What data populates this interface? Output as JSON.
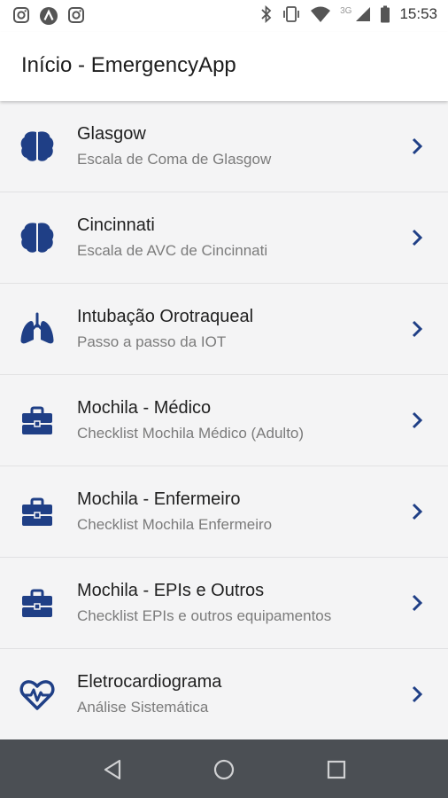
{
  "status_bar": {
    "time": "15:53",
    "network": "3G",
    "left_icons": [
      "instagram-icon",
      "app-a-icon",
      "instagram-icon"
    ],
    "right_icons": [
      "bluetooth-icon",
      "vibrate-icon",
      "wifi-icon",
      "signal-icon",
      "battery-icon"
    ]
  },
  "app_bar": {
    "title": "Início - EmergencyApp"
  },
  "colors": {
    "accent": "#1f3f86",
    "background": "#f4f4f5",
    "nav_bar": "#4b4f54"
  },
  "menu": {
    "items": [
      {
        "title": "Glasgow",
        "subtitle": "Escala de Coma de Glasgow",
        "icon": "brain-icon"
      },
      {
        "title": "Cincinnati",
        "subtitle": "Escala de AVC de Cincinnati",
        "icon": "brain-icon"
      },
      {
        "title": "Intubação Orotraqueal",
        "subtitle": "Passo a passo da IOT",
        "icon": "lungs-icon"
      },
      {
        "title": "Mochila - Médico",
        "subtitle": "Checklist Mochila Médico (Adulto)",
        "icon": "toolbox-icon"
      },
      {
        "title": "Mochila - Enfermeiro",
        "subtitle": "Checklist Mochila Enfermeiro",
        "icon": "toolbox-icon"
      },
      {
        "title": "Mochila - EPIs e Outros",
        "subtitle": "Checklist EPIs e outros equipamentos",
        "icon": "toolbox-icon"
      },
      {
        "title": "Eletrocardiograma",
        "subtitle": "Análise Sistemática",
        "icon": "heartbeat-icon"
      }
    ]
  },
  "nav_bar": {
    "buttons": [
      "back-icon",
      "home-icon",
      "recents-icon"
    ]
  }
}
